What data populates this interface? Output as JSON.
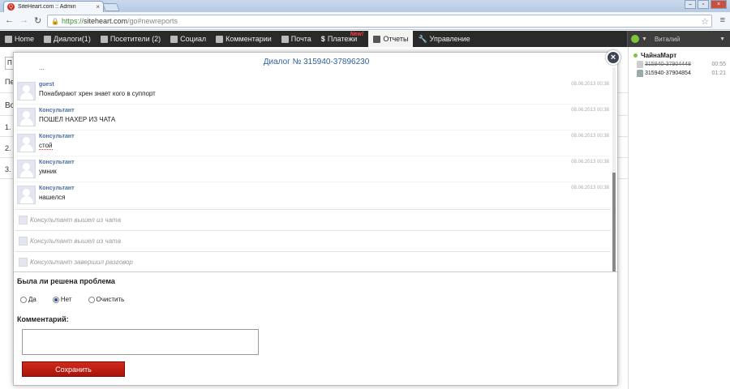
{
  "browser": {
    "tab_title": "SiteHeart.com :: Admin",
    "tab_favicon": "Q",
    "url_scheme": "https://",
    "url_host": "siteheart.com",
    "url_path": "/go#newreports"
  },
  "nav": {
    "items": [
      {
        "label": "Home",
        "icon": "home-icon"
      },
      {
        "label": "Диалоги(1)",
        "icon": "chat-icon"
      },
      {
        "label": "Посетители (2)",
        "icon": "users-icon"
      },
      {
        "label": "Социал",
        "icon": "social-icon"
      },
      {
        "label": "Комментарии",
        "icon": "comments-icon"
      },
      {
        "label": "Почта",
        "icon": "mail-icon"
      },
      {
        "label": "Платежи",
        "icon": "dollar-icon",
        "badge": "New!"
      },
      {
        "label": "Отчеты",
        "icon": "chart-icon",
        "active": true
      },
      {
        "label": "Управление",
        "icon": "wrench-icon"
      }
    ],
    "user_name": "Виталий"
  },
  "sidebar": {
    "group": "ЧайнаМарт",
    "visitors": [
      {
        "id": "315940-37904448",
        "time": "00:55",
        "offline": true
      },
      {
        "id": "315940-37904854",
        "time": "01:21",
        "offline": false
      }
    ]
  },
  "background": {
    "select_text": "П",
    "line1": "Пе",
    "heading": "Во",
    "items": [
      "1.",
      "2.",
      "3."
    ]
  },
  "dialog": {
    "title": "Диалог № 315940-37896230",
    "partial_text": "...",
    "messages": [
      {
        "author": "guest",
        "text": "Понабирают хрен знает кого в суппорт",
        "time": "08.06.2013 00:38"
      },
      {
        "author": "Консультант",
        "text": "ПОШЕЛ НАХЕР ИЗ ЧАТА",
        "time": "08.06.2013 00:38"
      },
      {
        "author": "Консультант",
        "text": "стой",
        "time": "08.06.2013 00:38"
      },
      {
        "author": "Консультант",
        "text": "умник",
        "time": "08.06.2013 00:38"
      },
      {
        "author": "Консультант",
        "text": "нашелся",
        "time": "08.06.2013 00:38"
      }
    ],
    "events": [
      "Консультант вышел из чата",
      "Консультант вышел из чата",
      "Консультант завершил разговор"
    ],
    "question": "Была ли решена проблема",
    "options": [
      {
        "label": "Да",
        "checked": false
      },
      {
        "label": "Нет",
        "checked": true
      },
      {
        "label": "Очистить",
        "checked": false
      }
    ],
    "comment_label": "Комментарий:",
    "comment_value": "",
    "save_label": "Сохранить"
  },
  "colors": {
    "accent": "#2e5f9e",
    "save_button": "#c11f12",
    "nav_bg": "#2a2a2a",
    "status_online": "#7cc43a"
  }
}
